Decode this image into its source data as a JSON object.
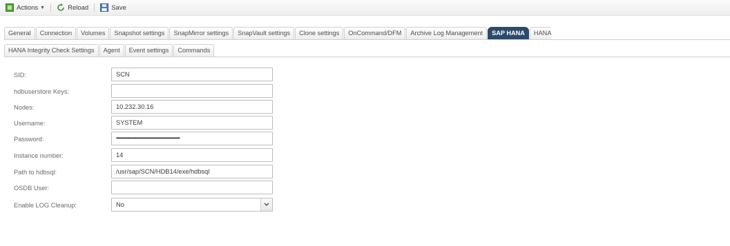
{
  "toolbar": {
    "actions_label": "Actions",
    "reload_label": "Reload",
    "save_label": "Save"
  },
  "tabs_row1": [
    {
      "label": "General"
    },
    {
      "label": "Connection"
    },
    {
      "label": "Volumes"
    },
    {
      "label": "Snapshot settings"
    },
    {
      "label": "SnapMirror settings"
    },
    {
      "label": "SnapVault settings"
    },
    {
      "label": "Clone settings"
    },
    {
      "label": "OnCommand/DFM"
    },
    {
      "label": "Archive Log Management"
    },
    {
      "label": "SAP HANA"
    },
    {
      "label": "HANA"
    }
  ],
  "tabs_row2": [
    {
      "label": "HANA Integrity Check Settings"
    },
    {
      "label": "Agent"
    },
    {
      "label": "Event settings"
    },
    {
      "label": "Commands"
    }
  ],
  "active_tab": "SAP HANA",
  "form": {
    "sid": {
      "label": "SID:",
      "value": "SCN"
    },
    "hdbuserstore_keys": {
      "label": "hdbuserstore Keys:",
      "value": ""
    },
    "nodes": {
      "label": "Nodes:",
      "value": "10.232.30.16"
    },
    "username": {
      "label": "Username:",
      "value": "SYSTEM"
    },
    "password": {
      "label": "Password:",
      "value": "•••••••••••••••••••••••••••••••••••••••••••••••••••"
    },
    "instance_number": {
      "label": "Instance number:",
      "value": "14"
    },
    "path_to_hdbsql": {
      "label": "Path to hdbsql:",
      "value": "/usr/sap/SCN/HDB14/exe/hdbsql"
    },
    "osdb_user": {
      "label": "OSDB User:",
      "value": ""
    },
    "enable_log_cleanup": {
      "label": "Enable LOG Cleanup:",
      "value": "No"
    }
  },
  "colors": {
    "active_tab_bg": "#2c4a6a",
    "active_tab_text": "#ffffff"
  }
}
